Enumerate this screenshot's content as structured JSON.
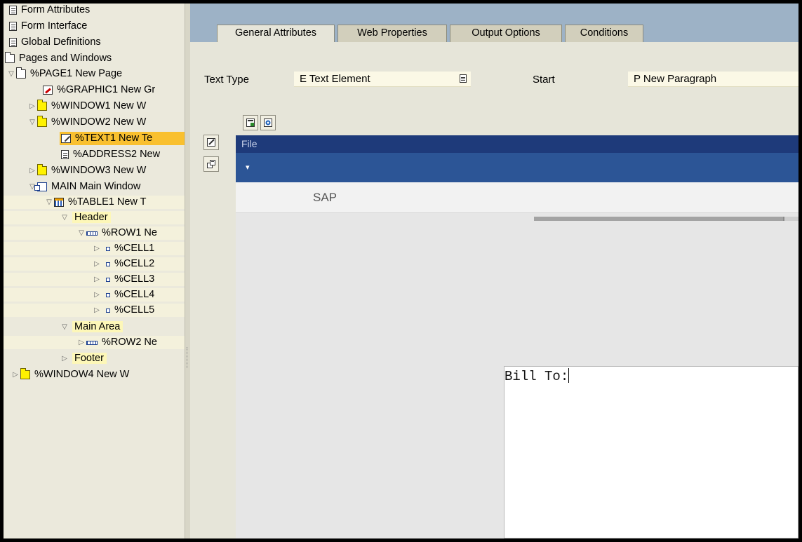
{
  "tree": {
    "items": [
      {
        "label": "Form Attributes",
        "icon": "document-icon"
      },
      {
        "label": "Form Interface",
        "icon": "document-icon"
      },
      {
        "label": "Global Definitions",
        "icon": "document-icon"
      },
      {
        "label": "Pages and Windows",
        "icon": "folder-icon"
      },
      {
        "label": "%PAGE1 New Page",
        "icon": "page-folder-icon"
      },
      {
        "label": "%GRAPHIC1 New Gr",
        "icon": "graphic-icon"
      },
      {
        "label": "%WINDOW1 New W",
        "icon": "window-icon"
      },
      {
        "label": "%WINDOW2 New W",
        "icon": "window-icon"
      },
      {
        "label": "%TEXT1 New Te",
        "icon": "text-icon"
      },
      {
        "label": "%ADDRESS2 New",
        "icon": "address-icon"
      },
      {
        "label": "%WINDOW3 New W",
        "icon": "window-icon"
      },
      {
        "label": "MAIN Main Window",
        "icon": "main-window-icon"
      },
      {
        "label": "%TABLE1 New T",
        "icon": "table-icon"
      },
      {
        "label": "Header",
        "icon": ""
      },
      {
        "label": "%ROW1 Ne",
        "icon": "row-icon"
      },
      {
        "label": "%CELL1",
        "icon": "cell-icon"
      },
      {
        "label": "%CELL2",
        "icon": "cell-icon"
      },
      {
        "label": "%CELL3",
        "icon": "cell-icon"
      },
      {
        "label": "%CELL4",
        "icon": "cell-icon"
      },
      {
        "label": "%CELL5",
        "icon": "cell-icon"
      },
      {
        "label": "Main Area",
        "icon": ""
      },
      {
        "label": "%ROW2 Ne",
        "icon": "row-icon"
      },
      {
        "label": "Footer",
        "icon": ""
      },
      {
        "label": "%WINDOW4 New W",
        "icon": "window-icon"
      }
    ]
  },
  "tabs": [
    {
      "label": "General Attributes",
      "active": true
    },
    {
      "label": "Web Properties",
      "active": false
    },
    {
      "label": "Output Options",
      "active": false
    },
    {
      "label": "Conditions",
      "active": false
    }
  ],
  "attributes": {
    "text_type_label": "Text Type",
    "text_type_value": "E Text Element",
    "start_label": "Start",
    "start_value": "P New Paragraph"
  },
  "editor": {
    "menu_file": "File",
    "toolbar_glyph": "▾",
    "brand": "SAP",
    "content": "Bill To:"
  },
  "colors": {
    "selection": "#f9c02f",
    "editor_menubar": "#1e3a7a",
    "editor_toolbar": "#2c5596",
    "tab_strip": "#9db2c6"
  }
}
